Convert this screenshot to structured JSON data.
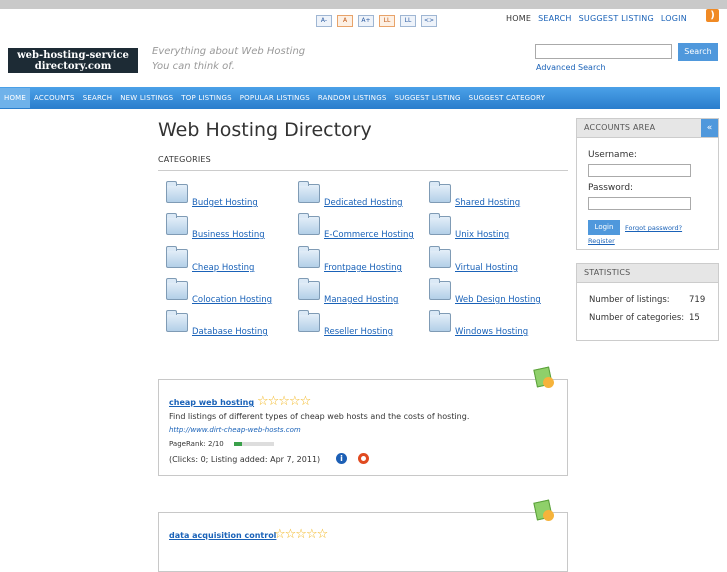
{
  "font_size_buttons": [
    "A-",
    "A",
    "A+",
    "LL",
    "LL",
    "<>"
  ],
  "top_links": [
    "HOME",
    "SEARCH",
    "SUGGEST LISTING",
    "LOGIN"
  ],
  "logo_lines": [
    "web-hosting-service",
    "directory.com"
  ],
  "tagline": [
    "Everything about Web Hosting",
    "You can think of."
  ],
  "search": {
    "button": "Search",
    "advanced": "Advanced Search",
    "value": ""
  },
  "nav": [
    "HOME",
    "ACCOUNTS",
    "SEARCH",
    "NEW LISTINGS",
    "TOP LISTINGS",
    "POPULAR LISTINGS",
    "RANDOM LISTINGS",
    "SUGGEST LISTING",
    "SUGGEST CATEGORY"
  ],
  "page_title": "Web Hosting Directory",
  "categories_label": "CATEGORIES",
  "categories": [
    [
      "Budget Hosting",
      "Dedicated Hosting",
      "Shared Hosting"
    ],
    [
      "Business Hosting",
      "E-Commerce Hosting",
      "Unix Hosting"
    ],
    [
      "Cheap Hosting",
      "Frontpage Hosting",
      "Virtual Hosting"
    ],
    [
      "Colocation Hosting",
      "Managed Hosting",
      "Web Design Hosting"
    ],
    [
      "Database Hosting",
      "Reseller Hosting",
      "Windows Hosting"
    ]
  ],
  "listings": [
    {
      "title": "cheap web hosting",
      "stars": "☆☆☆☆☆",
      "description": "Find listings of different types of cheap web hosts and the costs of hosting.",
      "url": "http://www.dirt-cheap-web-hosts.com",
      "pagerank": "PageRank: 2/10",
      "pagerank_value": 0.2,
      "clicks": "(Clicks: 0; Listing added: Apr 7, 2011)"
    },
    {
      "title": "data acquisition control",
      "stars": "☆☆☆☆☆"
    }
  ],
  "accounts": {
    "title": "ACCOUNTS AREA",
    "collapse": "«",
    "username_label": "Username:",
    "password_label": "Password:",
    "login_button": "Login",
    "forgot": "Forgot password?",
    "register": "Register"
  },
  "stats": {
    "title": "STATISTICS",
    "listings_label": "Number of listings:",
    "listings_value": "719",
    "categories_label": "Number of categories:",
    "categories_value": "15"
  }
}
